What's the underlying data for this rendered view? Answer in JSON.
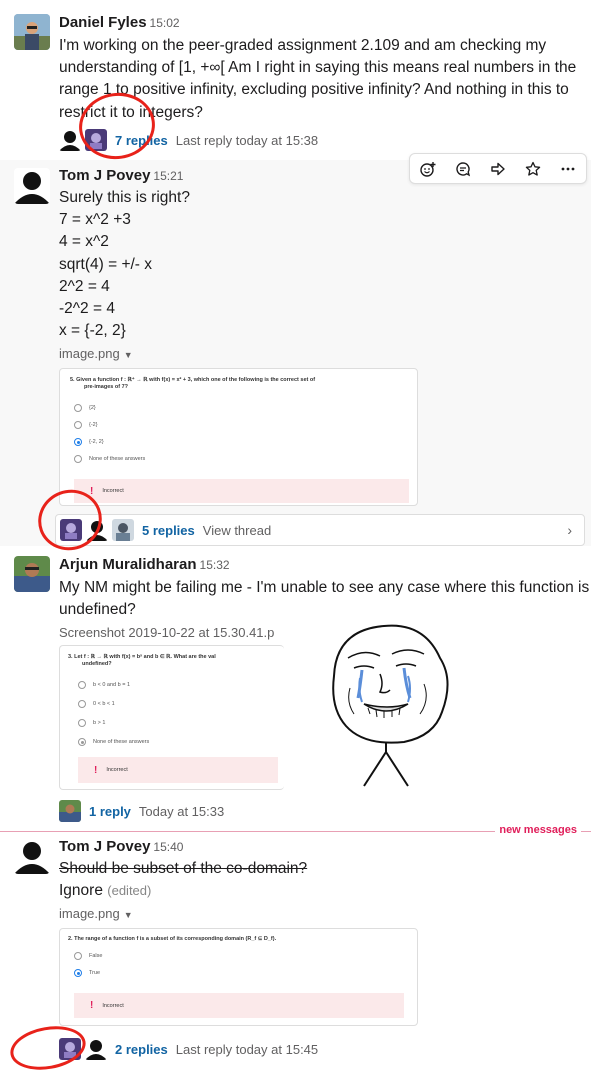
{
  "messages": [
    {
      "author": "Daniel Fyles",
      "time": "15:02",
      "lines": [
        "I'm working on the peer-graded assignment 2.109 and am checking my",
        "understanding of [1, +∞[ Am I right in saying this means real numbers in the",
        "range 1 to positive infinity, excluding positive infinity? And nothing in this to",
        "restrict it to integers?"
      ],
      "thread": {
        "replies": "7 replies",
        "last": "Last reply today at 15:38"
      }
    },
    {
      "author": "Tom J Povey",
      "time": "15:21",
      "lines": [
        "Surely this is right?",
        "7 = x^2 +3",
        "4 = x^2",
        "sqrt(4) = +/- x",
        "2^2 = 4",
        "-2^2 = 4",
        "x = {-2, 2}"
      ],
      "file_name": "image.png",
      "attachment": {
        "question": "5.   Given a function f : ℝ⁺ → ℝ with f(x) = x² + 3, which one of the following is the correct set of",
        "question2": "pre-images of 7?",
        "options": [
          "{2}",
          "{-2}",
          "{-2, 2}",
          "None of these answers"
        ],
        "result": "Incorrect"
      },
      "thread": {
        "replies": "5 replies",
        "last": "View thread"
      }
    },
    {
      "author": "Arjun Muralidharan",
      "time": "15:32",
      "lines": [
        "My NM might be failing me - I'm unable to see any case where this function is",
        "undefined?"
      ],
      "file_name": "Screenshot 2019-10-22 at 15.30.41.p",
      "attachment": {
        "question": "3.   Let f : ℝ → ℝ with f(x) = bˣ and b ∈ ℝ. What are the val",
        "question2": "undefined?",
        "options": [
          "b < 0 and b = 1",
          "0 < b < 1",
          "b > 1",
          "None of these answers"
        ],
        "result": "Incorrect"
      },
      "thread": {
        "replies": "1 reply",
        "last": "Today at 15:33"
      }
    },
    {
      "author": "Tom J Povey",
      "time": "15:40",
      "line_struck": "Should be subset of the co-domain?",
      "line_plain": "Ignore",
      "edited": "(edited)",
      "file_name": "image.png",
      "attachment": {
        "question": "2.   The range of a function f is a subset of its corresponding domain (R_f ⊆ D_f).",
        "options": [
          "False",
          "True"
        ],
        "result": "Incorrect"
      },
      "thread": {
        "replies": "2 replies",
        "last": "Last reply today at 15:45"
      }
    }
  ],
  "divider_label": "new messages",
  "toolbar_icons": [
    "add-reaction-icon",
    "reply-in-thread-icon",
    "share-message-icon",
    "save-star-icon",
    "more-actions-icon"
  ],
  "colors": {
    "link": "#1264a3",
    "new_messages": "#e01e5a",
    "annotation": "#e8221a",
    "incorrect_bg": "#fbe9ea",
    "selected_radio": "#1f7ee8"
  }
}
